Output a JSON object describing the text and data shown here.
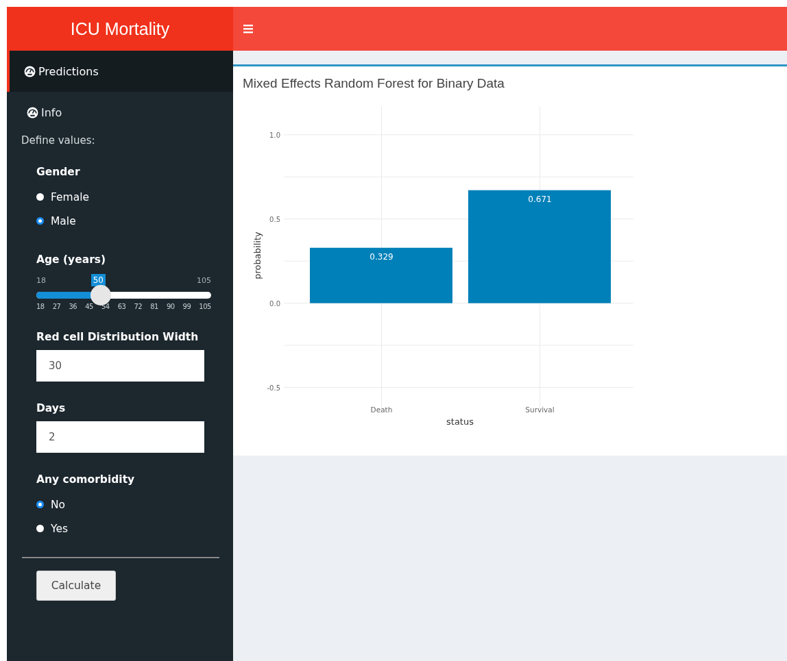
{
  "header": {
    "title": "ICU Mortality"
  },
  "sidebar": {
    "menu": [
      {
        "label": "Predictions",
        "selected": true
      },
      {
        "label": "Info",
        "selected": false
      }
    ],
    "section_label": "Define values:",
    "inputs": [
      {
        "kind": "radio",
        "label": "Gender",
        "options": [
          {
            "label": "Female",
            "selected": false
          },
          {
            "label": "Male",
            "selected": true
          }
        ]
      },
      {
        "kind": "slider",
        "label": "Age (years)",
        "min": "18",
        "max": "105",
        "value": "50",
        "level": 0.368,
        "ticks": [
          "18",
          "27",
          "36",
          "45",
          "54",
          "63",
          "72",
          "81",
          "90",
          "99",
          "105"
        ]
      },
      {
        "kind": "number",
        "label": "Red cell Distribution Width",
        "value": "30"
      },
      {
        "kind": "number",
        "label": "Days",
        "value": "2"
      },
      {
        "kind": "radio",
        "label": "Any comorbidity",
        "options": [
          {
            "label": "No",
            "selected": true
          },
          {
            "label": "Yes",
            "selected": false
          }
        ]
      }
    ],
    "button": "Calculate"
  },
  "main": {
    "box_title": "Mixed Effects Random Forest for Binary Data",
    "chart_data": {
      "type": "bar",
      "xlabel": "status",
      "ylabel": "probability",
      "categories": [
        "Death",
        "Survival"
      ],
      "series": [
        {
          "color": "#0080b8",
          "values": [
            0.329,
            0.671
          ]
        }
      ],
      "value_labels": [
        "0.329",
        "0.671"
      ],
      "grid": true,
      "ylim": [
        -0.62,
        1.17
      ],
      "yticks": [
        {
          "value": -0.5,
          "label": "-0.5"
        },
        {
          "value": 0,
          "label": "0.0"
        },
        {
          "value": 0.5,
          "label": "0.5"
        },
        {
          "value": 1,
          "label": "1.0"
        }
      ]
    }
  }
}
